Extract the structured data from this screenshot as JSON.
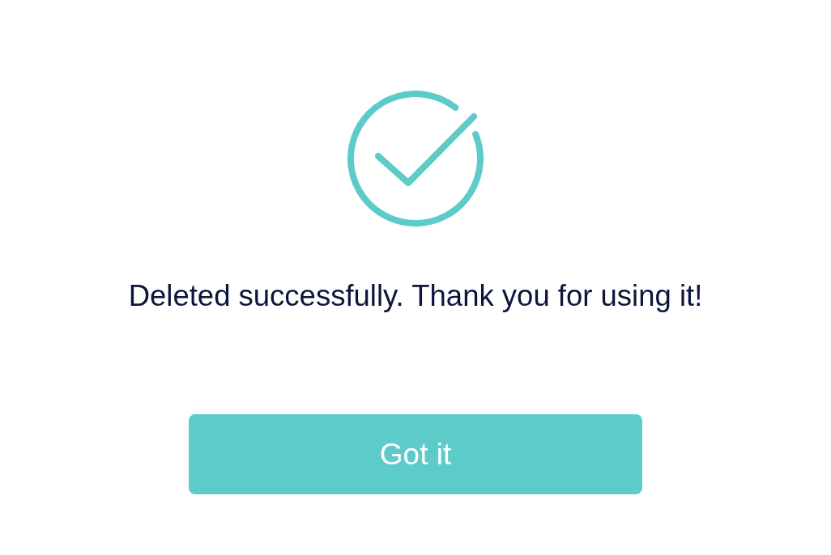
{
  "message": "Deleted successfully. Thank you for using it!",
  "button": {
    "label": "Got it"
  }
}
